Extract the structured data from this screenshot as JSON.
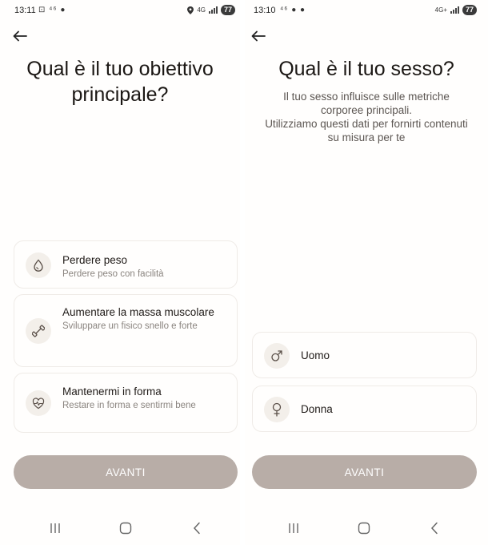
{
  "left_screen": {
    "status": {
      "time": "13:11",
      "notifications": "⊡ ⁴⁶ ●",
      "network": "4G",
      "battery": "77"
    },
    "title": "Qual è il tuo obiettivo principale?",
    "options": [
      {
        "title": "Perdere peso",
        "subtitle": "Perdere peso con facilità",
        "icon": "drop-icon"
      },
      {
        "title": "Aumentare la massa muscolare",
        "subtitle": "Sviluppare un fisico snello e forte",
        "icon": "dumbbell-icon"
      },
      {
        "title": "Mantenermi in forma",
        "subtitle": "Restare in forma e sentirmi bene",
        "icon": "heart-pulse-icon"
      }
    ],
    "cta_label": "AVANTI"
  },
  "right_screen": {
    "status": {
      "time": "13:10",
      "notifications": "⁴⁶ ● ●",
      "network": "4G+",
      "battery": "77"
    },
    "title": "Qual è il tuo sesso?",
    "subtitle_lines": [
      "Il tuo sesso influisce sulle metriche",
      "corporee principali.",
      "Utilizziamo questi dati per fornirti contenuti",
      "su misura per te"
    ],
    "options": [
      {
        "label": "Uomo",
        "icon": "male-symbol-icon"
      },
      {
        "label": "Donna",
        "icon": "female-symbol-icon"
      }
    ],
    "cta_label": "AVANTI"
  },
  "colors": {
    "cta_bg": "#b8ada7",
    "icon_bg": "#f3efea",
    "card_border": "#efebe7",
    "text_primary": "#1f1a17",
    "text_secondary": "#8a847f"
  }
}
